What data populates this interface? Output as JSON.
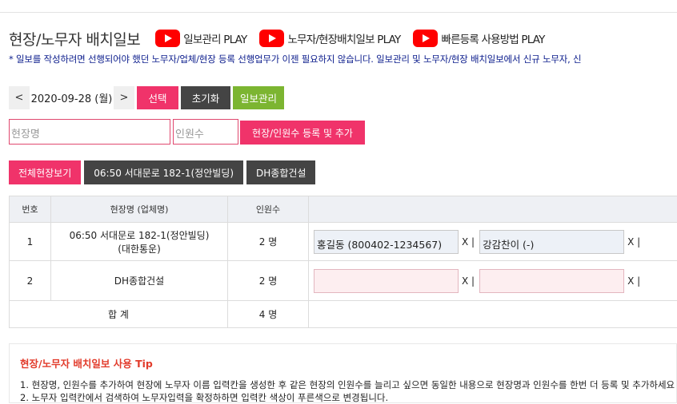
{
  "header": {
    "title": "현장/노무자 배치일보",
    "videos": [
      {
        "label": "일보관리 PLAY",
        "icon": "youtube-play-icon"
      },
      {
        "label": "노무자/현장배치일보 PLAY",
        "icon": "youtube-play-icon"
      },
      {
        "label": "빠른등록 사용방법 PLAY",
        "icon": "youtube-play-icon"
      }
    ],
    "notice": "* 일보를 작성하려면 선행되어야 했던 노무자/업체/현장 등록 선행업무가 이젠 필요하지 않습니다. 일보관리 및 노무자/현장 배치일보에서 신규 노무자, 신"
  },
  "datebar": {
    "prev": "<",
    "date": "2020-09-28 (월)",
    "next": ">",
    "select": "선택",
    "reset": "초기화",
    "manage": "일보관리"
  },
  "form": {
    "site_placeholder": "현장명",
    "count_placeholder": "인원수",
    "add_label": "현장/인원수 등록 및 추가"
  },
  "filters": [
    "전체현장보기",
    "06:50 서대문로 182-1(정안빌딩)",
    "DH종합건설"
  ],
  "colors": {
    "accent": "#f0336a",
    "dark": "#444444",
    "green": "#7cb531",
    "notice": "#0b1c8c"
  },
  "table": {
    "headers": {
      "no": "번호",
      "site": "현장명 (업체명)",
      "count": "인원수",
      "workers": ""
    },
    "rows": [
      {
        "no": "1",
        "site": "06:50 서대문로 182-1(정안빌딩)",
        "company": "(대한통운)",
        "count": "2 명",
        "workers": [
          "홍길동 (800402-1234567)",
          "강감찬이 (-)"
        ]
      },
      {
        "no": "2",
        "site": "DH종합건설",
        "company": "",
        "count": "2 명",
        "workers": [
          "",
          ""
        ]
      }
    ],
    "x_label": "X |",
    "total_label": "합 계",
    "total_count": "4 명"
  },
  "tip": {
    "title": "현장/노무자 배치일보 사용 Tip",
    "line1": "1. 현장명, 인원수를 추가하여 현장에 노무자 이름 입력칸을 생성한 후 같은 현장의 인원수를 늘리고 싶으면 동일한 내용으로 현장명과 인원수를 한번 더 등록 및 추가하세요",
    "line2": "2. 노무자 입력칸에서 검색하여 노무자입력을 확정하하면 입력칸 색상이 푸른색으로 변경됩니다."
  }
}
